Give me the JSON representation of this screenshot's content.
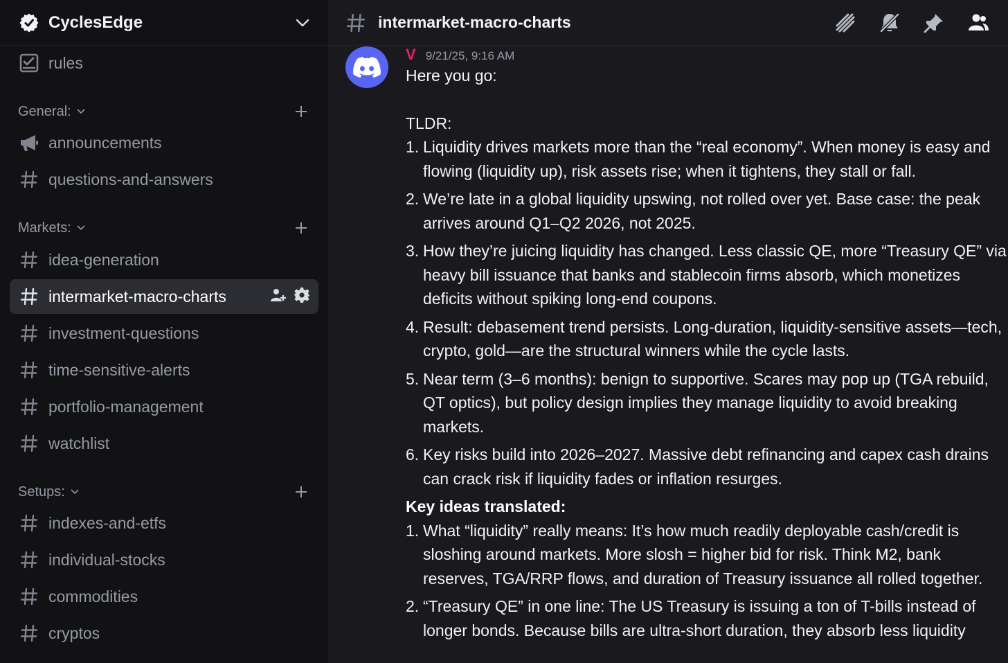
{
  "server": {
    "name": "CyclesEdge"
  },
  "sidebar": {
    "top_channel": {
      "label": "rules",
      "icon": "rules-checkbox-icon"
    },
    "categories": [
      {
        "label": "General:",
        "channels": [
          {
            "label": "announcements",
            "icon": "megaphone-icon"
          },
          {
            "label": "questions-and-answers",
            "icon": "hash-icon"
          }
        ]
      },
      {
        "label": "Markets:",
        "channels": [
          {
            "label": "idea-generation",
            "icon": "hash-icon"
          },
          {
            "label": "intermarket-macro-charts",
            "icon": "hash-icon",
            "active": true
          },
          {
            "label": "investment-questions",
            "icon": "hash-icon"
          },
          {
            "label": "time-sensitive-alerts",
            "icon": "hash-icon"
          },
          {
            "label": "portfolio-management",
            "icon": "hash-icon"
          },
          {
            "label": "watchlist",
            "icon": "hash-icon"
          }
        ]
      },
      {
        "label": "Setups:",
        "channels": [
          {
            "label": "indexes-and-etfs",
            "icon": "hash-icon"
          },
          {
            "label": "individual-stocks",
            "icon": "hash-icon"
          },
          {
            "label": "commodities",
            "icon": "hash-icon"
          },
          {
            "label": "cryptos",
            "icon": "hash-icon"
          }
        ]
      }
    ]
  },
  "channel_header": {
    "title": "intermarket-macro-charts",
    "tools": [
      "threads-icon",
      "mute-bell-icon",
      "pin-icon",
      "members-icon"
    ]
  },
  "message": {
    "author": "V",
    "timestamp": "9/21/25, 9:16 AM",
    "intro": "Here you go:",
    "tldr_label": "TLDR:",
    "tldr": [
      {
        "num": "1.",
        "text": "Liquidity drives markets more than the “real economy”. When money is easy and flowing (liquidity up), risk assets rise; when it tightens, they stall or fall."
      },
      {
        "num": "2.",
        "text": "We’re late in a global liquidity upswing, not rolled over yet. Base case: the peak arrives around Q1–Q2 2026, not 2025."
      },
      {
        "num": "3.",
        "text": "How they’re juicing liquidity has changed. Less classic QE, more “Treasury QE” via heavy bill issuance that banks and stablecoin firms absorb, which monetizes deficits without spiking long-end coupons."
      },
      {
        "num": "4.",
        "text": "Result: debasement trend persists. Long-duration, liquidity-sensitive assets—tech, crypto, gold—are the structural winners while the cycle lasts."
      },
      {
        "num": "5.",
        "text": "Near term (3–6 months): benign to supportive. Scares may pop up (TGA rebuild, QT optics), but policy design implies they manage liquidity to avoid breaking markets."
      },
      {
        "num": "6.",
        "text": "Key risks build into 2026–2027. Massive debt refinancing and capex cash drains can crack risk if liquidity fades or inflation resurges."
      }
    ],
    "key_ideas_label": "Key ideas translated:",
    "key_ideas": [
      {
        "num": "1.",
        "text": "What “liquidity” really means: It’s how much readily deployable cash/credit is sloshing around markets. More slosh = higher bid for risk. Think M2, bank reserves, TGA/RRP flows, and duration of Treasury issuance all rolled together."
      },
      {
        "num": "2.",
        "text": "“Treasury QE” in one line: The US Treasury is issuing a ton of T-bills instead of longer bonds. Because bills are ultra-short duration, they absorb less liquidity"
      }
    ]
  },
  "colors": {
    "sidebar_bg": "#121214",
    "main_bg": "#1a1a1e",
    "active_channel_bg": "#2c2d32",
    "author": "#e91e63",
    "avatar": "#5865f2",
    "muted_text": "#949ba4"
  }
}
